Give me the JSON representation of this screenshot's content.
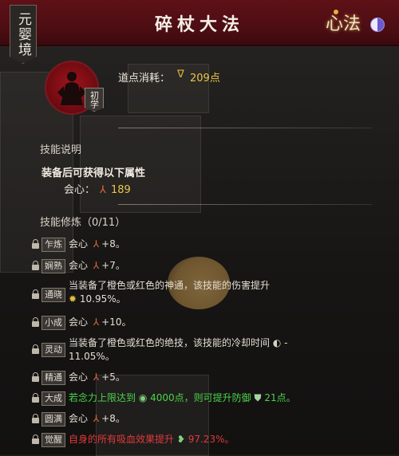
{
  "header": {
    "realm": "元婴境",
    "title": "碎杖大法",
    "badge": "心法"
  },
  "skill": {
    "rank": "初学",
    "cost_label": "道点消耗：",
    "cost_value": "209点"
  },
  "description": {
    "title": "技能说明",
    "line": "装备后可获得以下属性",
    "attr_label": "会心：",
    "attr_value": "189"
  },
  "cultivation": {
    "title": "技能修炼（0/11）",
    "rows": [
      {
        "tag": "乍炼",
        "text": "会心 ",
        "suffix": "+8。"
      },
      {
        "tag": "娴熟",
        "text": "会心 ",
        "suffix": "+7。"
      },
      {
        "tag": "通晓",
        "line1": "当装备了橙色或红色的神通，该技能的伤害提升",
        "line2": "10.95%。"
      },
      {
        "tag": "小成",
        "text": "会心 ",
        "suffix": "+10。"
      },
      {
        "tag": "灵动",
        "line1": "当装备了橙色或红色的绝技，该技能的冷却时间",
        "line1_suffix": " -",
        "line2": "11.05%。"
      },
      {
        "tag": "精通",
        "text": "会心 ",
        "suffix": "+5。"
      },
      {
        "tag": "大成",
        "text_a": "若念力上限达到 ",
        "text_b": "4000点，则可提升防御 ",
        "text_c": "21点。"
      },
      {
        "tag": "圆满",
        "text": "会心 ",
        "suffix": "+8。"
      },
      {
        "tag": "觉醒",
        "text_a": "自身的所有吸血效果提升 ",
        "text_b": "97.23%。"
      }
    ]
  },
  "colors": {
    "header": "#5e1117",
    "gold": "#e9c64a",
    "green": "#4bd34b",
    "red": "#e03a3a"
  }
}
